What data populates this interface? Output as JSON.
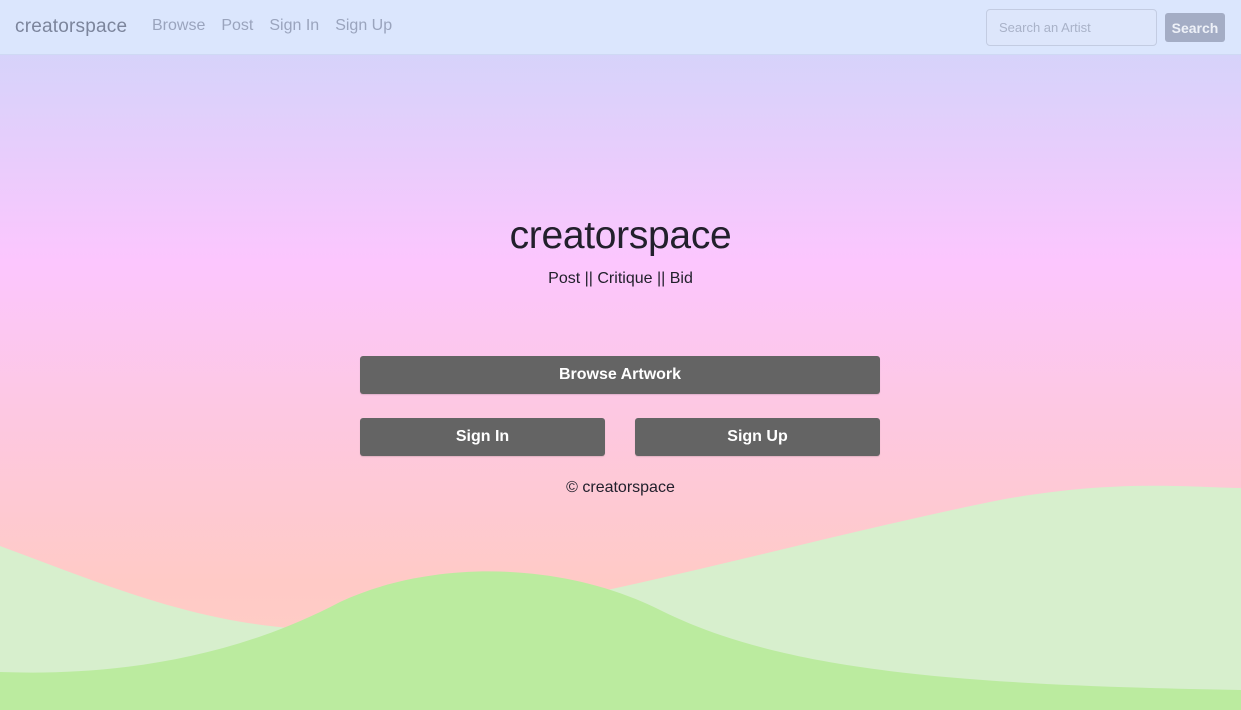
{
  "nav": {
    "brand": "creatorspace",
    "links": [
      "Browse",
      "Post",
      "Sign In",
      "Sign Up"
    ],
    "search_placeholder": "Search an Artist",
    "search_button": "Search"
  },
  "hero": {
    "title": "creatorspace",
    "subtitle": "Post || Critique || Bid",
    "browse_button": "Browse Artwork",
    "signin_button": "Sign In",
    "signup_button": "Sign Up",
    "footer": "© creatorspace"
  },
  "colors": {
    "navbar_bg": "#dbe6fd",
    "button_bg": "#646464",
    "hill_light": "#d7efcd",
    "hill_dark": "#bbeb9f"
  }
}
